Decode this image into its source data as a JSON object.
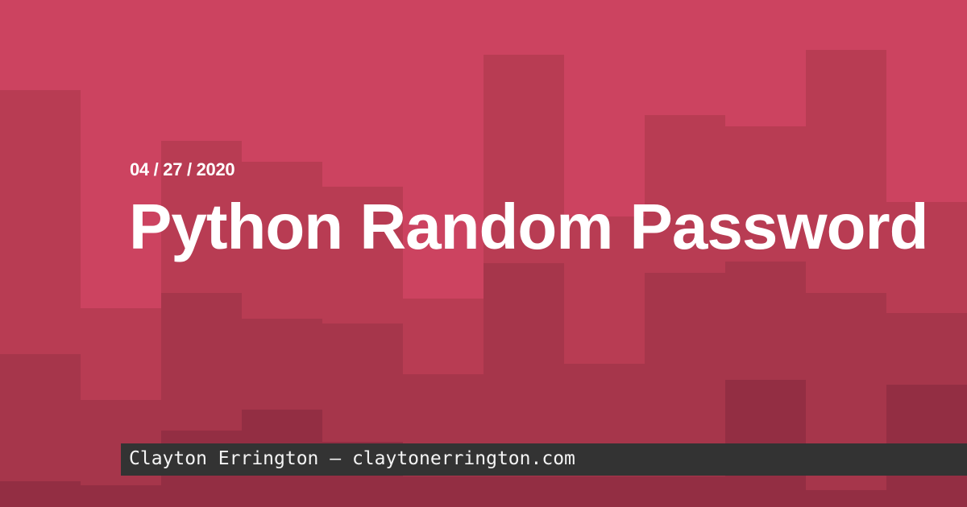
{
  "post": {
    "date": "04 / 27 / 2020",
    "title": "Python Random Password"
  },
  "footer": {
    "byline": "Clayton Errington — claytonerrington.com"
  },
  "colors": {
    "base": "#cc4360",
    "layer1": "#b83c53",
    "layer2": "#a6364b",
    "layer3": "#932e43",
    "footer_bg": "#333333",
    "text": "#ffffff"
  }
}
